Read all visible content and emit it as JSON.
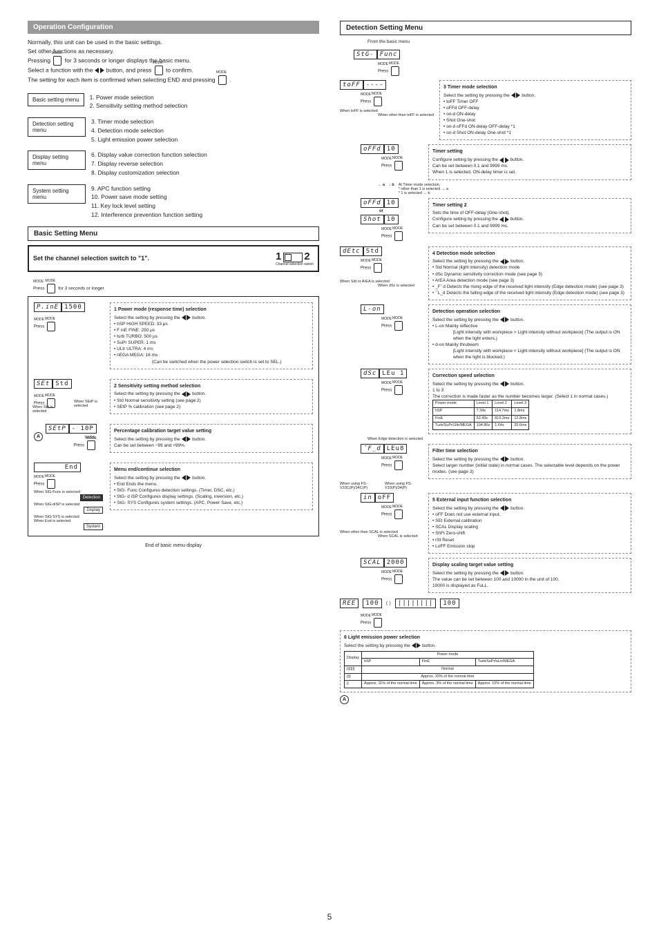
{
  "page_number": "5",
  "left": {
    "op_conf_title": "Operation Configuration",
    "intro_l1": "Normally, this unit can be used in the basic settings.",
    "intro_l2": "Set other functions as necessary.",
    "intro_l3a": "Pressing ",
    "intro_l3b": " for 3 seconds or longer displays the basic menu.",
    "intro_l4a": "Select a function with the ",
    "intro_l4b": " button, and press ",
    "intro_l4c": " to confirm.",
    "intro_l5a": "The setting for each item is confirmed when selecting END and pressing ",
    "intro_l5b": " .",
    "basic_menu": "Basic setting menu",
    "basic_1": "1. Power mode selection",
    "basic_2": "2. Sensitivity setting method selection",
    "det_menu": "Detection setting menu",
    "det_3": "3. Timer mode selection",
    "det_4": "4. Detection mode selection",
    "det_5": "5. Light emission power selection",
    "disp_menu": "Display setting menu",
    "disp_6": "6. Display value correction function selection",
    "disp_7": "7. Display reverse selection",
    "disp_8": "8. Display customization selection",
    "sys_menu": "System setting menu",
    "sys_9": "9. APC function setting",
    "sys_10": "10. Power save mode setting",
    "sys_11": "11. Key lock level setting",
    "sys_12": "12. Interference prevention function setting",
    "bsm_title": "Basic Setting Menu",
    "set_switch": "Set the channel selection switch to \"1\".",
    "ch_sel": "Channel selection switch",
    "one": "1",
    "two": "2",
    "press3": "Press        for 3 seconds or longer",
    "seg_pine": "P.inE",
    "seg_1500": "1500",
    "press": "Press",
    "box1_title": "1 Power mode (response time) selection",
    "box_sel": "Select the setting by pressing the         button.",
    "b1_hsp": "hSP HIGH SPEED: 33 μs",
    "b1_fine": "F inE FINE: 250 μs",
    "b1_turbo": "turb TURBO: 500 μs",
    "b1_super": "SuPr SUPER: 1 ms",
    "b1_ultra": "ULtr ULTRA: 4 ms",
    "b1_mega": "nEGA MEGA: 16 ms",
    "b1_note": "(Can be switched when the power selection switch is set to SEL.)",
    "seg_set": "SEt",
    "seg_std": "Std",
    "when_std": "When Std is selected",
    "when_setp": "When SEtP is selected",
    "box2_title": "2 Sensitivity setting method selection",
    "b2_std": "Std Normal sensitivity setting (see page 2)",
    "b2_setp": "SEtP % calibration (see page 2)",
    "seg_setp": "SEtP",
    "seg_10p": "- 10P",
    "pct_title": "Percentage calibration target value setting",
    "pct_body": "Select the setting by pressing the        button.\nCan be set between −99 and +99%.",
    "seg_end": "End",
    "menu_end_title": "Menu end/continue selection",
    "me_end": "End Ends the menu.",
    "me_func": "StG- Func Configures detection settings. (Timer, DSC, etc.)",
    "me_disp": "StG- d iSP Configures display settings. (Scaling, inversion, etc.)",
    "me_sys": "StG-   SYS Configures system settings. (APC, Power Save, etc.)",
    "when_func": "When StG-Func is selected",
    "detection_btn": "Detection",
    "when_disp": "When StG-diSP is selected",
    "display_btn": "Display",
    "when_sys": "When StG-SYS is selected",
    "system_btn": "System",
    "when_end": "When End is selected",
    "end_basic": "End of basic menu display"
  },
  "right": {
    "dsm_title": "Detection Setting Menu",
    "from_basic": "From the basic menu",
    "seg_stg": "StG-",
    "seg_func": "Func",
    "press": "Press",
    "seg_toff": "toFF",
    "seg_dashes": "----",
    "when_toff": "When toFF is selected",
    "when_other_toff": "When other than toFF is selected",
    "box3_title": "3 Timer mode selection",
    "b3_toff": "toFF Timer OFF",
    "b3_offd": "oFFd OFF-delay",
    "b3_ond": "on-d ON-delay",
    "b3_shot": "Shot One-shot",
    "b3_ondoffd": "on-d oFFd ON-delay OFF-delay *1",
    "b3_ondshot": "on-d Shot ON-delay One-shot *1",
    "seg_offd": "oFFd",
    "seg_10": "10",
    "timer_set_title": "Timer setting",
    "timer_set_body": "Configure setting by pressing the        button.\nCan be set between 0.1 and 9999 ms.\nWhen 1 is selected, ON-delay timer is set.",
    "at_timer": "At Timer mode selection,\n* other than 1 is selected → a\n* 1 is selected → b",
    "a": "a",
    "b": "b",
    "or": "or",
    "timer2_title": "Timer setting 2",
    "timer2_body": "Sets the time of OFF-delay (One-shot).\nConfigure setting by pressing the        button.\nCan be set between 0.1 and 9999 ms.",
    "seg_shot": "Shot",
    "seg_detc": "dEtc",
    "seg_std": "Std",
    "when_detc_std": "When Std or ArEA is selected",
    "when_dsc": "When dSc is selected",
    "box4_title": "4 Detection mode selection",
    "b4_std": "Std Normal (light intensity) detection mode",
    "b4_dsc": "dSc Dynamic sensitivity correction mode (see page 3)",
    "b4_area": "ArEA Area detection mode (see page 3)",
    "b4_fd": "_F¯d Detects the rising edge of the received light intensity (Edge detection mode) (see page 3)",
    "b4_ld": "¯L_d Detects the falling edge of the received light intensity (Edge detection mode) (see page 3)",
    "seg_lon": "L-on",
    "det_op_title": "Detection operation selection",
    "do_lon_h": "L-on Mainly reflective",
    "do_lon": "[Light intensity with workpiece > Light intensity without workpiece] (The output is ON when the light enters.)",
    "do_don_h": "d-on Mainly thrubeam",
    "do_don": "[Light intensity with workpiece < Light intensity without workpiece] (The output is ON when the light is blocked.)",
    "seg_dsc": "dSc",
    "seg_leui": "LEu 1",
    "corr_title": "Correction speed selection",
    "corr_body": "Select the setting by pressing the        button.\n1 to 3\nThe correction is made faster as the number becomes larger. (Select 1 in normal cases.)",
    "corr_tbl_h": [
      "Power mode",
      "Level 1",
      "Level 2",
      "Level 3"
    ],
    "corr_tbl": [
      [
        "hSP",
        "7.34s",
        "114.7ms",
        "1.8ms"
      ],
      [
        "FinE",
        "52.43s",
        "819.2ms",
        "12.8ms"
      ],
      [
        "Turb/SuPr/Ultr/MEGA",
        "104.86s",
        "1.64s",
        "25.6ms"
      ]
    ],
    "when_edge": "When Edge detection is selected",
    "seg_fd": "¯F_d",
    "seg_leu8": "LEu8",
    "filter_title": "Filter time selection",
    "filter_body": "Select the setting by pressing the        button.\nSelect larger number (initial state) in normal cases. The selectable level depends on the power modes. (see page 3)",
    "when_v33c": "When using FS-V33C(P)/34C(P)",
    "when_v33": "When using FS-V33(P)/34(P)",
    "seg_in": "in",
    "seg_off": "oFF",
    "box5_title": "5 External input function selection",
    "b5_off": "oFF Does not use external input.",
    "b5_set": "SEt External calibration",
    "b5_scal": "SCAL Display scaling",
    "b5_shft": "ShFt Zero-shift",
    "b5_rst": "rSt Reset",
    "b5_loff": "LoFF Emission stop",
    "when_other_scal": "When other than SCAL is selected",
    "when_scal": "When SCAL is selected",
    "seg_scal": "SCAL",
    "seg_2000": "2000",
    "disp_scal_title": "Display scaling target value setting",
    "disp_scal_body": "Select the setting by pressing the        button.\nThe value can be set between 100 and 10000 in the unit of 100.\n10000 is displayed as FuLL.",
    "seg_ree": "REE",
    "seg_100": "100",
    "seg_bars": "||||||||",
    "box6_title": "6 Light emission power selection",
    "b6_tbl_hdr": [
      "",
      "Power mode"
    ],
    "b6_tbl_sub": [
      "Display",
      "hSP",
      "FinE",
      "Turb/SuPr/uLtr/MEGA"
    ],
    "b6_row1": [
      "||||||||",
      "Normal"
    ],
    "b6_row2": [
      "||||",
      "Approx. 15% of the normal time"
    ],
    "b6_row3": [
      "||",
      "Approx. 11% of the normal time",
      "Approx. 3% of the normal time",
      "Approx. 15% of the normal time"
    ]
  }
}
